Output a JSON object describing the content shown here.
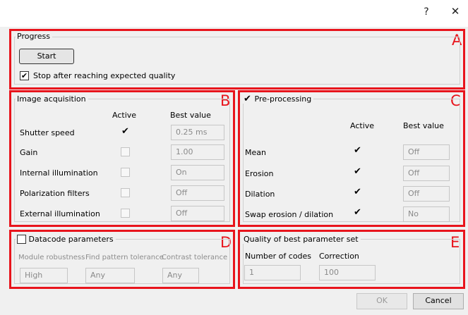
{
  "window": {
    "help_glyph": "?",
    "close_glyph": "✕"
  },
  "progress": {
    "title": "Progress",
    "letter": "A",
    "start_label": "Start",
    "stop_check": "✔",
    "stop_label": "Stop after reaching expected quality"
  },
  "acquisition": {
    "title": "Image acquisition",
    "letter": "B",
    "col_active": "Active",
    "col_best": "Best value",
    "rows": [
      {
        "label": "Shutter speed",
        "check": "✔",
        "value": "0.25 ms"
      },
      {
        "label": "Gain",
        "check": "",
        "value": "1.00"
      },
      {
        "label": "Internal illumination",
        "check": "",
        "value": "On"
      },
      {
        "label": "Polarization filters",
        "check": "",
        "value": "Off"
      },
      {
        "label": "External illumination",
        "check": "",
        "value": "Off"
      }
    ]
  },
  "preprocessing": {
    "title": "Pre-processing",
    "title_check": "✔",
    "letter": "C",
    "col_active": "Active",
    "col_best": "Best value",
    "rows": [
      {
        "label": "Mean",
        "check": "✔",
        "value": "Off"
      },
      {
        "label": "Erosion",
        "check": "✔",
        "value": "Off"
      },
      {
        "label": "Dilation",
        "check": "✔",
        "value": "Off"
      },
      {
        "label": "Swap erosion / dilation",
        "check": "✔",
        "value": "No"
      }
    ]
  },
  "datacode": {
    "title": "Datacode parameters",
    "letter": "D",
    "module_label": "Module robustness",
    "module_value": "High",
    "pattern_label": "Find pattern tolerance",
    "pattern_value": "Any",
    "contrast_label": "Contrast tolerance",
    "contrast_value": "Any"
  },
  "quality": {
    "title": "Quality of best parameter set",
    "letter": "E",
    "codes_label": "Number of codes",
    "codes_value": "1",
    "correction_label": "Correction",
    "correction_value": "100"
  },
  "footer": {
    "ok_label": "OK",
    "cancel_label": "Cancel"
  },
  "colors": {
    "annotation": "#e8141c",
    "background": "#f0f0f0",
    "titlebar": "#ffffff"
  }
}
